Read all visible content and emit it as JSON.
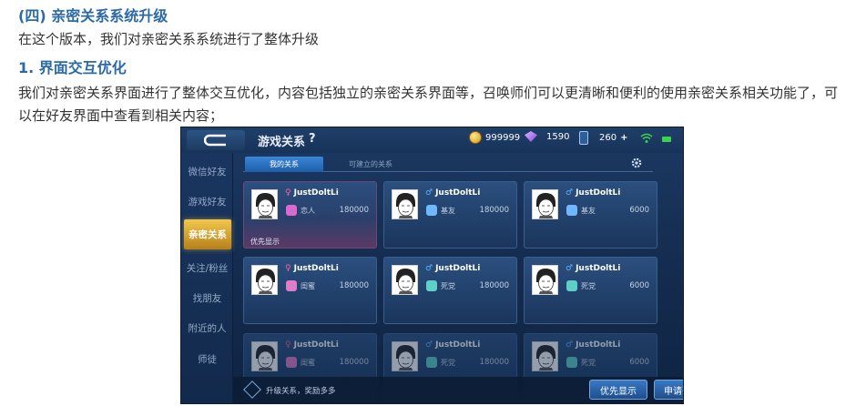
{
  "article": {
    "section_title": "(四) 亲密关系系统升级",
    "intro": "在这个版本，我们对亲密关系系统进行了整体升级",
    "sub_title": "1. 界面交互优化",
    "body": "我们对亲密关系界面进行了整体交互优化，内容包括独立的亲密关系界面等，召唤师们可以更清晰和便利的使用亲密关系相关功能了，可以在好友界面中查看到相关内容；"
  },
  "game": {
    "title": "游戏关系",
    "help": "?",
    "resources": {
      "gold": "999999",
      "diamonds": "1590",
      "coupons": "260",
      "plus": "+"
    },
    "sidebar": [
      {
        "label": "微信好友"
      },
      {
        "label": "游戏好友"
      },
      {
        "label": "亲密关系"
      },
      {
        "label": "关注/粉丝"
      },
      {
        "label": "找朋友"
      },
      {
        "label": "附近的人"
      },
      {
        "label": "师徒"
      }
    ],
    "tabs": [
      {
        "label": "我的关系"
      },
      {
        "label": "可建立的关系"
      }
    ],
    "cards": [
      {
        "gender": "♀",
        "name": "JustDoltLi",
        "relation": "恋人",
        "score": "180000",
        "priority": "优先显示"
      },
      {
        "gender": "♂",
        "name": "JustDoltLi",
        "relation": "基友",
        "score": "180000"
      },
      {
        "gender": "♂",
        "name": "JustDoltLi",
        "relation": "基友",
        "score": "6000"
      },
      {
        "gender": "♀",
        "name": "JustDoltLi",
        "relation": "闺蜜",
        "score": "180000"
      },
      {
        "gender": "♂",
        "name": "JustDoltLi",
        "relation": "死党",
        "score": "180000"
      },
      {
        "gender": "♂",
        "name": "JustDoltLi",
        "relation": "死党",
        "score": "6000"
      },
      {
        "gender": "♀",
        "name": "JustDoltLi",
        "relation": "闺蜜",
        "score": "180000"
      },
      {
        "gender": "♂",
        "name": "JustDoltLi",
        "relation": "死党",
        "score": "180000"
      },
      {
        "gender": "♂",
        "name": "JustDoltLi",
        "relation": "死党",
        "score": "6000"
      }
    ],
    "bottom": {
      "promo": "升级关系，奖励多多",
      "priority_button": "优先显示",
      "request_list_button": "申请列表"
    },
    "colors": {
      "accent": "#2b6aa6",
      "female": "#ff5fa8",
      "male": "#5ab4ff",
      "active_gold": "#f2c84b"
    }
  }
}
